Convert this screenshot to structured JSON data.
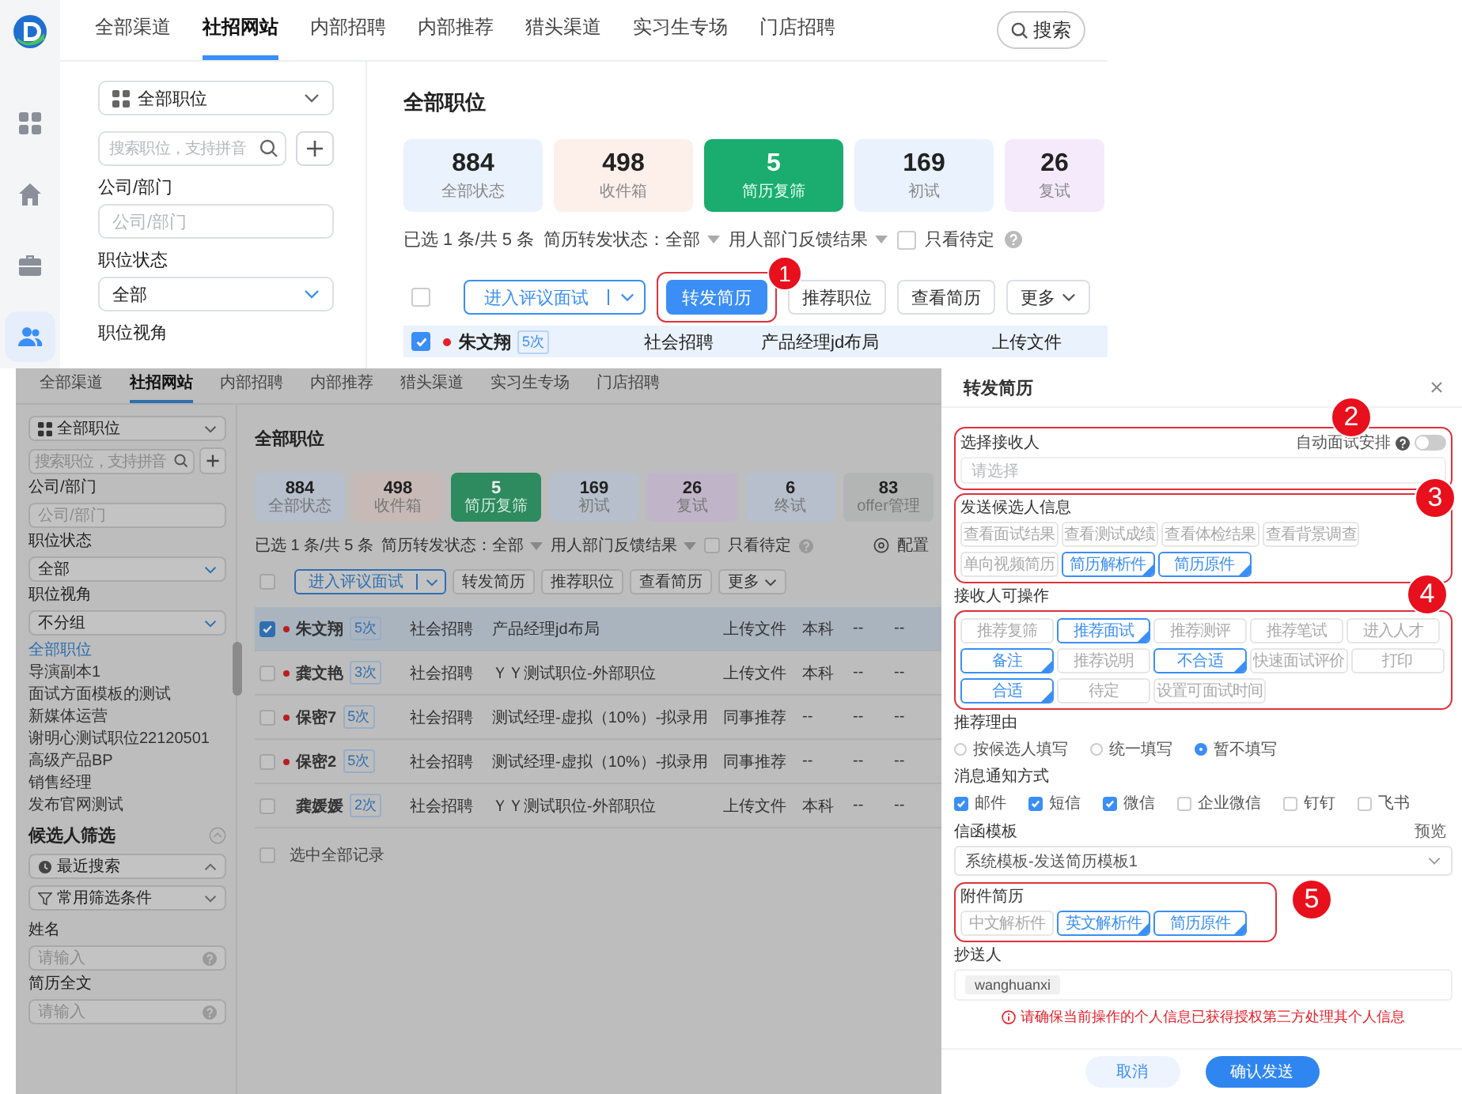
{
  "top": {
    "rail": [
      {
        "selected": false
      },
      {
        "selected": false
      },
      {
        "selected": false
      },
      {
        "selected": true
      }
    ],
    "nav_tabs": [
      {
        "label": "全部渠道",
        "selected": false
      },
      {
        "label": "社招网站",
        "selected": true
      },
      {
        "label": "内部招聘",
        "selected": false
      },
      {
        "label": "内部推荐",
        "selected": false
      },
      {
        "label": "猎头渠道",
        "selected": false
      },
      {
        "label": "实习生专场",
        "selected": false
      },
      {
        "label": "门店招聘",
        "selected": false
      }
    ],
    "search_button": "搜索",
    "sidebar": {
      "position_select": "全部职位",
      "search_placeholder": "搜索职位，支持拼音",
      "company_label": "公司/部门",
      "company_placeholder": "公司/部门",
      "status_label": "职位状态",
      "status_value": "全部",
      "view_label": "职位视角"
    },
    "heading": "全部职位",
    "stats": [
      {
        "value": "884",
        "label": "全部状态",
        "selected": false,
        "color": "#e9f2fd"
      },
      {
        "value": "498",
        "label": "收件箱",
        "selected": false,
        "color": "#fdefe9"
      },
      {
        "value": "5",
        "label": "简历复筛",
        "selected": true
      },
      {
        "value": "169",
        "label": "初试",
        "selected": false,
        "color": "#e9f2fd"
      },
      {
        "value": "26",
        "label": "复试",
        "selected": false,
        "color": "#f4eafc"
      }
    ],
    "filter": {
      "summary": "已选 1 条/共 5 条",
      "forward_status": "简历转发状态：全部",
      "feedback": "用人部门反馈结果",
      "pending_label": "只看待定",
      "pending_checked": false
    },
    "select_all_checked": false,
    "actions": [
      {
        "label": "进入评议面试",
        "kind": "split"
      },
      {
        "label": "转发简历",
        "kind": "primary",
        "callout": "1"
      },
      {
        "label": "推荐职位",
        "kind": "plain"
      },
      {
        "label": "查看简历",
        "kind": "plain"
      },
      {
        "label": "更多",
        "kind": "dropdown"
      }
    ],
    "rows": [
      {
        "name": "朱文翔",
        "count": "5次",
        "unread": true,
        "selected": true,
        "source": "社会招聘",
        "position": "产品经理jd布局",
        "column_4": "上传文件"
      }
    ]
  },
  "dimmed": {
    "nav_tabs": [
      {
        "label": "全部渠道",
        "selected": false
      },
      {
        "label": "社招网站",
        "selected": true
      },
      {
        "label": "内部招聘",
        "selected": false
      },
      {
        "label": "内部推荐",
        "selected": false
      },
      {
        "label": "猎头渠道",
        "selected": false
      },
      {
        "label": "实习生专场",
        "selected": false
      },
      {
        "label": "门店招聘",
        "selected": false
      }
    ],
    "sidebar": {
      "position_select": "全部职位",
      "search_placeholder": "搜索职位，支持拼音",
      "company_label": "公司/部门",
      "company_placeholder": "公司/部门",
      "status_label": "职位状态",
      "status_value": "全部",
      "view_label": "职位视角",
      "view_value": "不分组",
      "positions": [
        {
          "label": "全部职位",
          "selected": true
        },
        {
          "label": "导演副本1",
          "selected": false
        },
        {
          "label": "面试方面模板的测试",
          "selected": false
        },
        {
          "label": "新媒体运营",
          "selected": false
        },
        {
          "label": "谢明心测试职位22120501",
          "selected": false
        },
        {
          "label": "高级产品BP",
          "selected": false
        },
        {
          "label": "销售经理",
          "selected": false
        },
        {
          "label": "发布官网测试",
          "selected": false
        }
      ],
      "filter_title": "候选人筛选",
      "filter_selects": [
        {
          "label": "最近搜索",
          "expanded": true
        },
        {
          "label": "常用筛选条件",
          "expanded": false
        }
      ],
      "fields": [
        {
          "label": "姓名",
          "placeholder": "请输入"
        },
        {
          "label": "简历全文",
          "placeholder": "请输入"
        }
      ]
    },
    "heading": "全部职位",
    "stats": [
      {
        "value": "884",
        "label": "全部状态",
        "selected": false,
        "color": "#b6bfcb"
      },
      {
        "value": "498",
        "label": "收件箱",
        "selected": false,
        "color": "#c6b9b6"
      },
      {
        "value": "5",
        "label": "简历复筛",
        "selected": true
      },
      {
        "value": "169",
        "label": "初试",
        "selected": false,
        "color": "#b6bfcb"
      },
      {
        "value": "26",
        "label": "复试",
        "selected": false,
        "color": "#c0b5c8"
      },
      {
        "value": "6",
        "label": "终试",
        "selected": false,
        "color": "#b6bfcb"
      },
      {
        "value": "83",
        "label": "offer管理",
        "selected": false,
        "color": "#b3b5b4"
      }
    ],
    "filter": {
      "summary": "已选 1 条/共 5 条",
      "forward_status": "简历转发状态：全部",
      "feedback": "用人部门反馈结果",
      "pending_label": "只看待定",
      "pending_checked": false,
      "config": "配置"
    },
    "select_all_checked": false,
    "actions": [
      {
        "label": "进入评议面试",
        "kind": "split"
      },
      {
        "label": "转发简历",
        "kind": "plain"
      },
      {
        "label": "推荐职位",
        "kind": "plain"
      },
      {
        "label": "查看简历",
        "kind": "plain"
      },
      {
        "label": "更多",
        "kind": "dropdown"
      }
    ],
    "rows": [
      {
        "name": "朱文翔",
        "count": "5次",
        "unread": true,
        "selected": true,
        "source": "社会招聘",
        "position": "产品经理jd布局",
        "column_4": "上传文件",
        "column_5": "本科",
        "column_6": "--",
        "column_7": "--"
      },
      {
        "name": "龚文艳",
        "count": "3次",
        "unread": true,
        "selected": false,
        "source": "社会招聘",
        "position": "ＹＹ测试职位-外部职位",
        "column_4": "上传文件",
        "column_5": "本科",
        "column_6": "--",
        "column_7": "--"
      },
      {
        "name": "保密7",
        "count": "5次",
        "unread": true,
        "selected": false,
        "source": "社会招聘",
        "position": "测试经理-虚拟（10%）-拟录用",
        "column_4": "同事推荐",
        "column_5": "--",
        "column_6": "--",
        "column_7": "--"
      },
      {
        "name": "保密2",
        "count": "5次",
        "unread": true,
        "selected": false,
        "source": "社会招聘",
        "position": "测试经理-虚拟（10%）-拟录用",
        "column_4": "同事推荐",
        "column_5": "--",
        "column_6": "--",
        "column_7": "--"
      },
      {
        "name": "龚媛媛",
        "count": "2次",
        "unread": false,
        "selected": false,
        "source": "社会招聘",
        "position": "ＹＹ测试职位-外部职位",
        "column_4": "上传文件",
        "column_5": "本科",
        "column_6": "--",
        "column_7": "--"
      }
    ],
    "select_all_label": "选中全部记录",
    "select_all_records_checked": false
  },
  "drawer": {
    "title": "转发简历",
    "receiver": {
      "label": "选择接收人",
      "auto_label": "自动面试安排",
      "auto_on": false,
      "placeholder": "请选择",
      "callout": "2"
    },
    "send_info": {
      "label": "发送候选人信息",
      "callout": "3",
      "options": [
        {
          "label": "查看面试结果",
          "selected": false
        },
        {
          "label": "查看测试成绩",
          "selected": false
        },
        {
          "label": "查看体检结果",
          "selected": false
        },
        {
          "label": "查看背景调查",
          "selected": false
        },
        {
          "label": "单向视频简历",
          "selected": false
        },
        {
          "label": "简历解析件",
          "selected": true
        },
        {
          "label": "简历原件",
          "selected": true
        }
      ]
    },
    "receiver_actions": {
      "label": "接收人可操作",
      "callout": "4",
      "options": [
        {
          "label": "推荐复筛",
          "selected": false
        },
        {
          "label": "推荐面试",
          "selected": true
        },
        {
          "label": "推荐测评",
          "selected": false
        },
        {
          "label": "推荐笔试",
          "selected": false
        },
        {
          "label": "进入人才",
          "selected": false
        },
        {
          "label": "备注",
          "selected": true
        },
        {
          "label": "推荐说明",
          "selected": false
        },
        {
          "label": "不合适",
          "selected": true
        },
        {
          "label": "快速面试评价",
          "selected": false
        },
        {
          "label": "打印",
          "selected": false
        },
        {
          "label": "合适",
          "selected": true
        },
        {
          "label": "待定",
          "selected": false
        },
        {
          "label": "设置可面试时间",
          "selected": false
        }
      ]
    },
    "reason": {
      "label": "推荐理由",
      "options": [
        {
          "label": "按候选人填写",
          "selected": false
        },
        {
          "label": "统一填写",
          "selected": false
        },
        {
          "label": "暂不填写",
          "selected": true
        }
      ]
    },
    "notify": {
      "label": "消息通知方式",
      "options": [
        {
          "label": "邮件",
          "checked": true
        },
        {
          "label": "短信",
          "checked": true
        },
        {
          "label": "微信",
          "checked": true
        },
        {
          "label": "企业微信",
          "checked": false
        },
        {
          "label": "钉钉",
          "checked": false
        },
        {
          "label": "飞书",
          "checked": false
        }
      ]
    },
    "template": {
      "label": "信函模板",
      "preview": "预览",
      "value": "系统模板-发送简历模板1"
    },
    "attachments": {
      "label": "附件简历",
      "callout": "5",
      "options": [
        {
          "label": "中文解析件",
          "selected": false
        },
        {
          "label": "英文解析件",
          "selected": true
        },
        {
          "label": "简历原件",
          "selected": true
        }
      ]
    },
    "cc": {
      "label": "抄送人",
      "tags": [
        "wanghuanxi"
      ]
    },
    "warning": "请确保当前操作的个人信息已获得授权第三方处理其个人信息",
    "buttons": [
      {
        "label": "取消",
        "kind": "secondary"
      },
      {
        "label": "确认发送",
        "kind": "primary"
      }
    ]
  }
}
